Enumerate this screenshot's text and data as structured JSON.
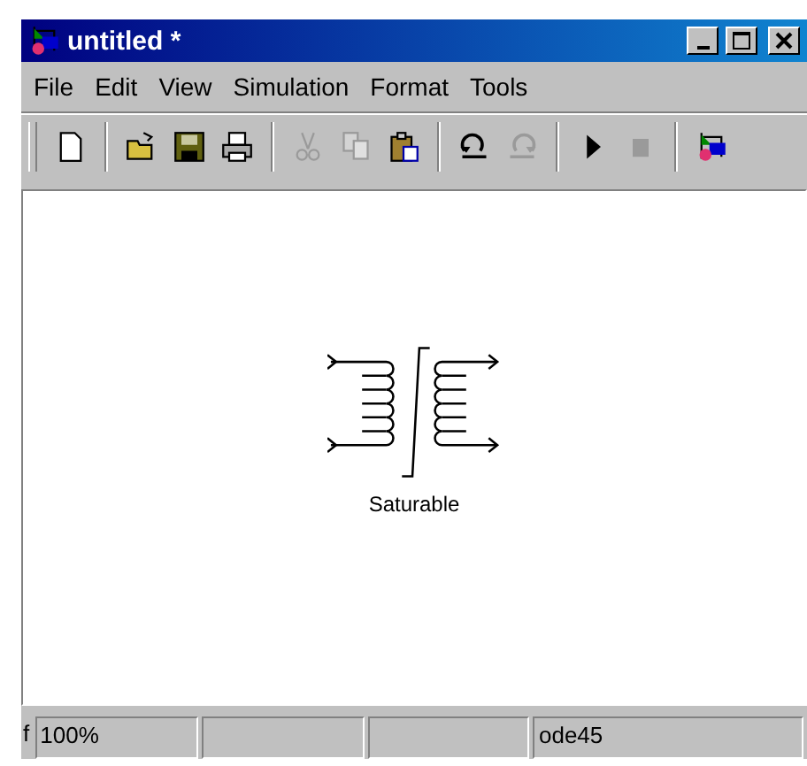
{
  "window": {
    "title": "untitled *"
  },
  "menu": [
    "File",
    "Edit",
    "View",
    "Simulation",
    "Format",
    "Tools"
  ],
  "toolbar": [
    {
      "kind": "new",
      "disabled": false
    },
    {
      "kind": "separator"
    },
    {
      "kind": "open",
      "disabled": false
    },
    {
      "kind": "save",
      "disabled": false
    },
    {
      "kind": "print",
      "disabled": false
    },
    {
      "kind": "separator"
    },
    {
      "kind": "cut",
      "disabled": true
    },
    {
      "kind": "copy",
      "disabled": true
    },
    {
      "kind": "paste",
      "disabled": false
    },
    {
      "kind": "separator"
    },
    {
      "kind": "undo",
      "disabled": false
    },
    {
      "kind": "redo",
      "disabled": true
    },
    {
      "kind": "separator"
    },
    {
      "kind": "start",
      "disabled": false
    },
    {
      "kind": "stop",
      "disabled": true
    },
    {
      "kind": "separator"
    },
    {
      "kind": "library",
      "disabled": false
    }
  ],
  "block": {
    "label": "Saturable"
  },
  "status_bar": {
    "left_cut": "f",
    "zoom": "100%",
    "solver": "ode45"
  }
}
